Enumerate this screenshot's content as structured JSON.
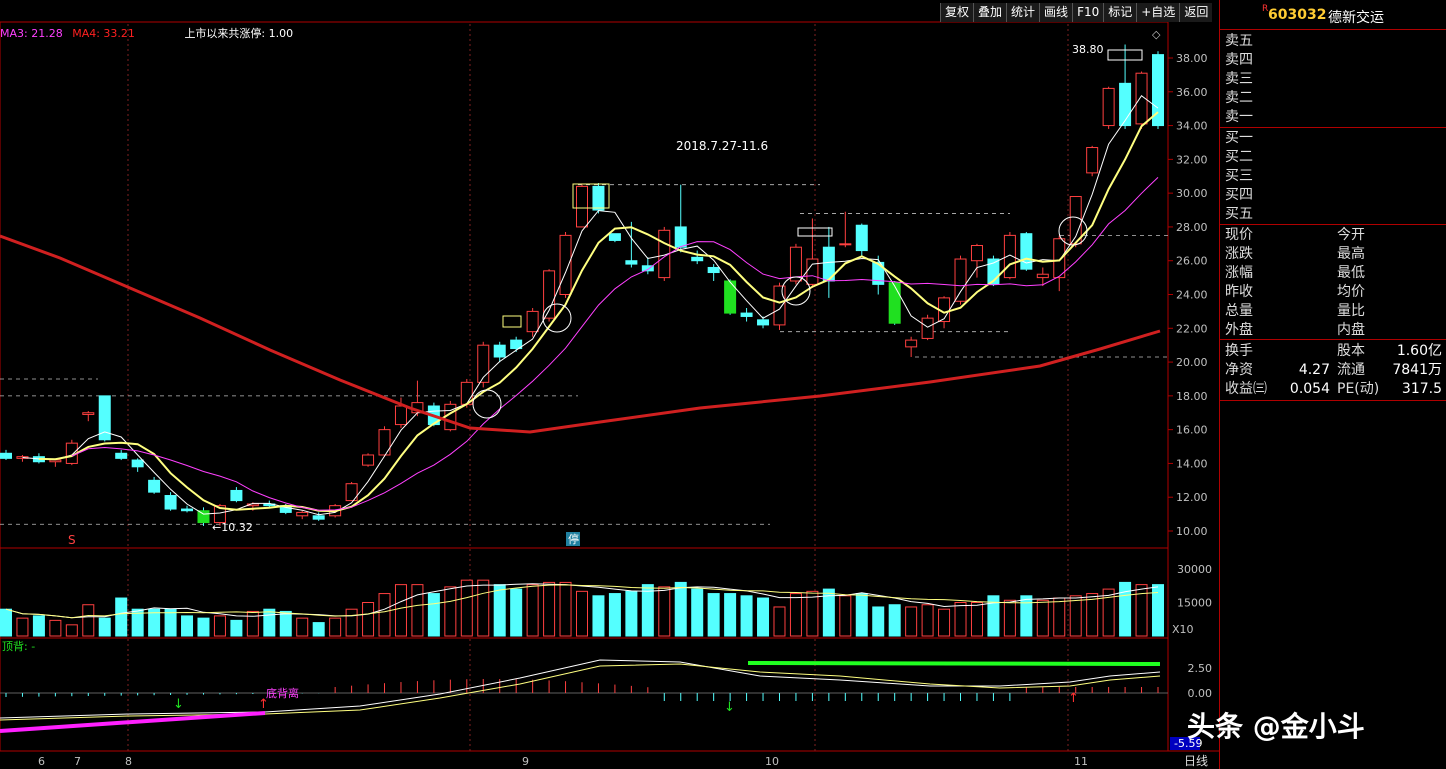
{
  "toolbar": {
    "items": [
      "复权",
      "叠加",
      "统计",
      "画线",
      "F10",
      "标记",
      "+自选",
      "返回"
    ]
  },
  "legend": {
    "ma3": "MA3: 21.28",
    "ma4": "MA4: 33.21",
    "limit_up": "上市以来共涨停: 1.00"
  },
  "stock": {
    "code": "603032",
    "name": "德新交运",
    "mark": "R"
  },
  "orderbook": {
    "sell": [
      "卖五",
      "卖四",
      "卖三",
      "卖二",
      "卖一"
    ],
    "buy": [
      "买一",
      "买二",
      "买三",
      "买四",
      "买五"
    ]
  },
  "quote_fields": [
    [
      "现价",
      "今开"
    ],
    [
      "涨跌",
      "最高"
    ],
    [
      "涨幅",
      "最低"
    ],
    [
      "昨收",
      "均价"
    ],
    [
      "总量",
      "量比"
    ],
    [
      "外盘",
      "内盘"
    ]
  ],
  "fundamentals": [
    {
      "label": "换手",
      "value": "",
      "label2": "股本",
      "value2": "1.60亿"
    },
    {
      "label": "净资",
      "value": "4.27",
      "label2": "流通",
      "value2": "7841万"
    },
    {
      "label": "收益㈢",
      "value": "0.054",
      "label2": "PE(动)",
      "value2": "317.5"
    }
  ],
  "price_axis": [
    "38.00",
    "36.00",
    "34.00",
    "32.00",
    "30.00",
    "28.00",
    "26.00",
    "24.00",
    "22.00",
    "20.00",
    "18.00",
    "16.00",
    "14.00",
    "12.00",
    "10.00"
  ],
  "volume_axis": [
    "30000",
    "15000"
  ],
  "volume_unit": "X10",
  "macd_axis": [
    "2.50",
    "0.00",
    "-5.59"
  ],
  "macd_label": "顶背: -",
  "annotations": {
    "period": "2018.7.27-11.6",
    "high": "38.80",
    "low": "10.32",
    "bottom_divergence": "底背离",
    "s_mark": "S",
    "stop_mark": "停"
  },
  "months": [
    "6",
    "7",
    "8",
    "9",
    "10",
    "11"
  ],
  "period_label": "日线",
  "watermark": "头条 @金小斗",
  "colors": {
    "up": "#ff4040",
    "down": "#54ffff",
    "ma1": "#ffffff",
    "ma2": "#ffff80",
    "ma3": "#ff40ff",
    "ma4": "#ff2020"
  },
  "chart_data": {
    "type": "candlestick",
    "candles": [
      [
        14.6,
        14.8,
        14.2,
        14.3
      ],
      [
        14.3,
        14.5,
        14.1,
        14.4
      ],
      [
        14.4,
        14.6,
        14.0,
        14.1
      ],
      [
        14.1,
        14.3,
        13.8,
        14.2
      ],
      [
        14.0,
        15.4,
        13.9,
        15.2
      ],
      [
        16.9,
        17.1,
        16.5,
        17.0
      ],
      [
        18.0,
        18.0,
        15.3,
        15.4
      ],
      [
        14.6,
        14.8,
        14.2,
        14.3
      ],
      [
        14.2,
        14.3,
        13.5,
        13.8
      ],
      [
        13.0,
        13.2,
        12.2,
        12.3
      ],
      [
        12.1,
        12.3,
        11.2,
        11.3
      ],
      [
        11.3,
        11.5,
        11.1,
        11.2
      ],
      [
        11.2,
        11.4,
        10.3,
        10.5
      ],
      [
        10.5,
        11.6,
        10.32,
        11.5
      ],
      [
        12.4,
        12.6,
        11.7,
        11.8
      ],
      [
        11.5,
        11.7,
        11.2,
        11.6
      ],
      [
        11.6,
        11.8,
        11.4,
        11.5
      ],
      [
        11.5,
        11.6,
        11.0,
        11.1
      ],
      [
        10.9,
        11.2,
        10.7,
        11.1
      ],
      [
        10.9,
        11.1,
        10.6,
        10.7
      ],
      [
        10.9,
        11.6,
        10.8,
        11.5
      ],
      [
        11.8,
        12.9,
        11.8,
        12.8
      ],
      [
        13.9,
        14.6,
        13.8,
        14.5
      ],
      [
        14.5,
        16.2,
        14.4,
        16.0
      ],
      [
        16.3,
        17.9,
        16.1,
        17.4
      ],
      [
        17.0,
        18.9,
        16.8,
        17.6
      ],
      [
        17.4,
        17.6,
        16.2,
        16.3
      ],
      [
        16.0,
        17.7,
        15.9,
        17.5
      ],
      [
        17.5,
        19.0,
        17.3,
        18.8
      ],
      [
        18.8,
        21.2,
        18.5,
        21.0
      ],
      [
        21.0,
        21.2,
        20.0,
        20.3
      ],
      [
        21.3,
        21.5,
        20.6,
        20.8
      ],
      [
        21.8,
        23.2,
        21.5,
        23.0
      ],
      [
        22.6,
        25.5,
        22.4,
        25.4
      ],
      [
        24.0,
        27.7,
        23.8,
        27.5
      ],
      [
        28.0,
        30.5,
        28.0,
        30.4
      ],
      [
        30.4,
        30.6,
        28.8,
        29.0
      ],
      [
        27.6,
        27.6,
        27.1,
        27.2
      ],
      [
        26.0,
        28.3,
        25.6,
        25.8
      ],
      [
        25.7,
        26.2,
        25.2,
        25.4
      ],
      [
        25.0,
        28.0,
        24.8,
        27.8
      ],
      [
        28.0,
        30.5,
        26.5,
        26.8
      ],
      [
        26.2,
        26.6,
        25.8,
        26.0
      ],
      [
        25.6,
        25.8,
        24.8,
        25.3
      ],
      [
        24.8,
        24.9,
        22.8,
        22.9
      ],
      [
        22.9,
        23.2,
        22.4,
        22.7
      ],
      [
        22.5,
        22.7,
        22.0,
        22.2
      ],
      [
        22.2,
        24.7,
        21.9,
        24.5
      ],
      [
        24.8,
        27.0,
        24.6,
        26.8
      ],
      [
        24.6,
        28.5,
        24.4,
        26.1
      ],
      [
        26.8,
        28.0,
        23.8,
        24.8
      ],
      [
        27.0,
        28.9,
        26.8,
        27.0
      ],
      [
        28.1,
        28.2,
        26.3,
        26.6
      ],
      [
        25.9,
        26.3,
        24.0,
        24.6
      ],
      [
        24.7,
        24.8,
        22.2,
        22.3
      ],
      [
        20.9,
        21.5,
        20.3,
        21.3
      ],
      [
        21.4,
        22.8,
        21.3,
        22.6
      ],
      [
        22.4,
        23.9,
        22.0,
        23.8
      ],
      [
        23.6,
        26.3,
        23.4,
        26.1
      ],
      [
        26.0,
        27.0,
        25.0,
        26.9
      ],
      [
        26.1,
        26.3,
        24.5,
        24.6
      ],
      [
        25.0,
        27.7,
        24.9,
        27.5
      ],
      [
        27.6,
        27.7,
        25.4,
        25.5
      ],
      [
        25.0,
        25.6,
        24.5,
        25.2
      ],
      [
        25.0,
        27.5,
        24.2,
        27.3
      ],
      [
        27.0,
        29.8,
        26.8,
        29.8
      ],
      [
        31.2,
        32.8,
        31.0,
        32.7
      ],
      [
        34.0,
        36.3,
        33.8,
        36.2
      ],
      [
        36.5,
        38.8,
        33.8,
        34.0
      ],
      [
        34.1,
        37.2,
        33.8,
        37.1
      ],
      [
        38.2,
        38.4,
        33.8,
        34.0
      ]
    ],
    "volume": [
      1200,
      800,
      900,
      700,
      500,
      1400,
      800,
      1700,
      1200,
      1200,
      1200,
      900,
      800,
      900,
      700,
      1100,
      1200,
      1100,
      800,
      600,
      800,
      1200,
      1500,
      1900,
      2300,
      2300,
      1900,
      2200,
      2500,
      2500,
      2300,
      2100,
      2300,
      2400,
      2400,
      2000,
      1800,
      1900,
      2000,
      2300,
      2200,
      2400,
      2100,
      1900,
      1900,
      1800,
      1700,
      1300,
      1900,
      2000,
      2100,
      1800,
      1900,
      1300,
      1400,
      1300,
      1400,
      1200,
      1500,
      1500,
      1800,
      1600,
      1800,
      1600,
      1700,
      1800,
      1900,
      2100,
      2400,
      2300,
      2300
    ]
  }
}
